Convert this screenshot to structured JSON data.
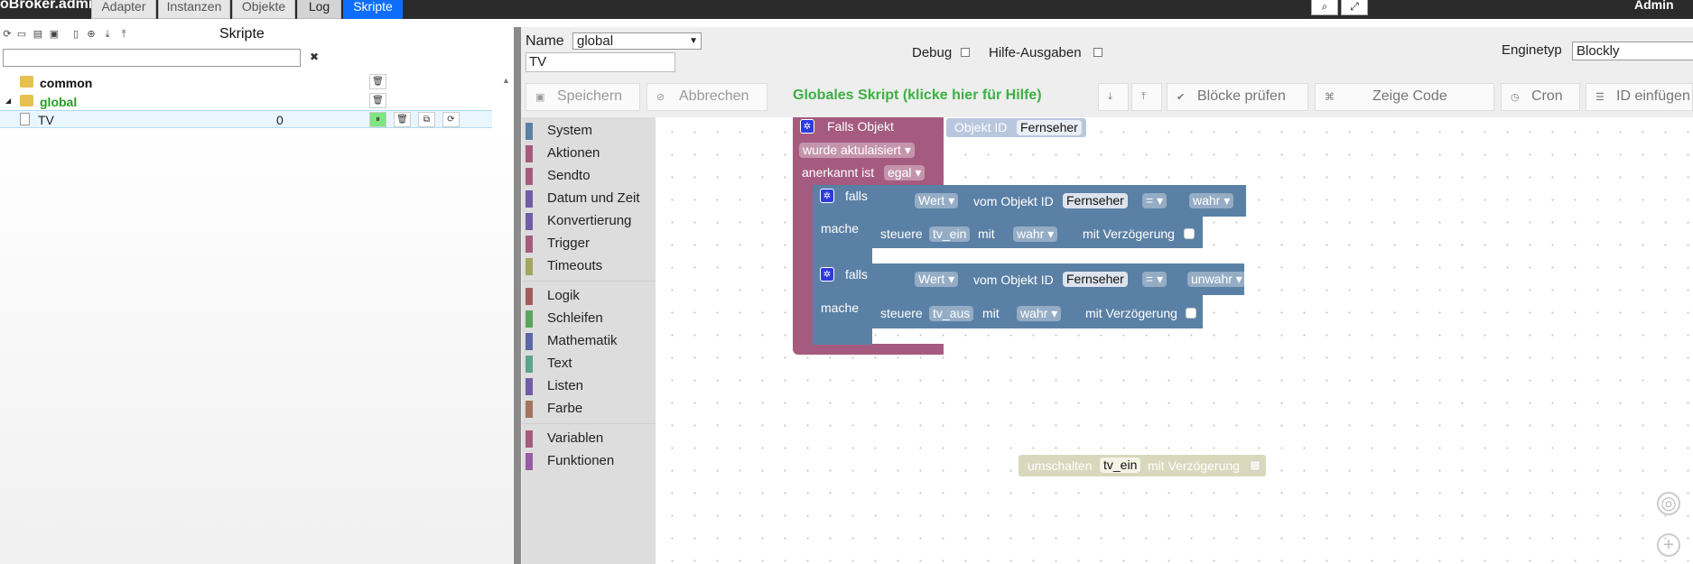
{
  "topbar": {
    "brand": "oBroker.admin",
    "tabs": [
      "Adapter",
      "Instanzen",
      "Objekte",
      "Log",
      "Skripte"
    ],
    "admin_label": "Admin"
  },
  "left": {
    "title": "Skripte",
    "search_value": "",
    "tree": [
      {
        "name": "common",
        "type": "folder"
      },
      {
        "name": "global",
        "type": "folder"
      },
      {
        "name": "TV",
        "type": "script",
        "value": "0"
      }
    ]
  },
  "editor": {
    "name_label": "Name",
    "name_value": "global",
    "script_name": "TV",
    "debug_label": "Debug",
    "hilfe_label": "Hilfe-Ausgaben",
    "engine_label": "Enginetyp",
    "engine_value": "Blockly",
    "toolbar": {
      "save": "Speichern",
      "cancel": "Abbrechen",
      "global_hint": "Globales Skript (klicke hier für Hilfe)",
      "check_blocks": "Blöcke prüfen",
      "show_code": "Zeige Code",
      "cron": "Cron",
      "insert_id": "ID einfügen"
    },
    "categories_1": [
      "System",
      "Aktionen",
      "Sendto",
      "Datum und Zeit",
      "Konvertierung",
      "Trigger",
      "Timeouts"
    ],
    "categories_2": [
      "Logik",
      "Schleifen",
      "Mathematik",
      "Text",
      "Listen",
      "Farbe"
    ],
    "categories_3": [
      "Variablen",
      "Funktionen"
    ],
    "category_colors": {
      "system": "#5b80a5",
      "aktionen": "#a55b80",
      "sendto": "#a55b80",
      "datum": "#745ba5",
      "konvertierung": "#745ba5",
      "trigger": "#a55b80",
      "timeouts": "#a5a55b",
      "logik": "#a55b5b",
      "schleifen": "#5ba55b",
      "mathematik": "#5b67a5",
      "text": "#5ba58c",
      "listen": "#745ba5",
      "farbe": "#a5745b",
      "variablen": "#a55b80",
      "funktionen": "#995ba5"
    },
    "blocks": {
      "trigger_title": "Falls Objekt",
      "objekt_id_label": "Objekt ID",
      "objekt_id_value": "Fernseher",
      "event": "wurde aktulaisiert",
      "anerkannt_label": "anerkannt ist",
      "anerkannt_value": "egal",
      "if1": {
        "falls": "falls",
        "wert": "Wert",
        "vom_objekt": "vom Objekt ID",
        "obj": "Fernseher",
        "op": "=",
        "value": "wahr",
        "mache": "mache",
        "steuere": "steuere",
        "target": "tv_ein",
        "mit": "mit",
        "mit_value": "wahr",
        "delay": "mit Verzögerung"
      },
      "if2": {
        "falls": "falls",
        "wert": "Wert",
        "vom_objekt": "vom Objekt ID",
        "obj": "Fernseher",
        "op": "=",
        "value": "unwahr",
        "mache": "mache",
        "steuere": "steuere",
        "target": "tv_aus",
        "mit": "mit",
        "mit_value": "wahr",
        "delay": "mit Verzögerung"
      },
      "loose": {
        "umschalten": "umschalten",
        "target": "tv_ein",
        "delay": "mit Verzögerung"
      }
    }
  }
}
